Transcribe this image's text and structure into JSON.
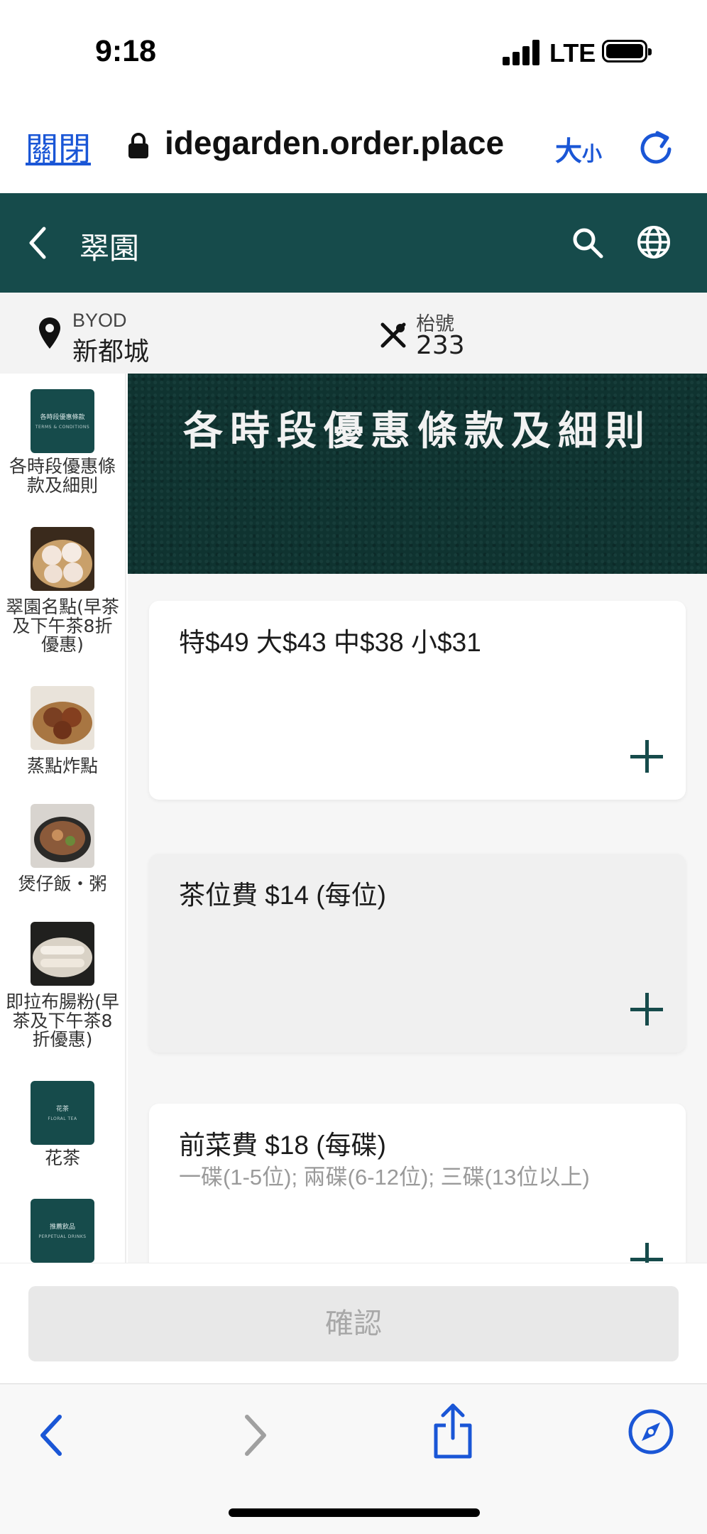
{
  "status_bar": {
    "time": "9:18",
    "network": "LTE"
  },
  "browser": {
    "close_label": "關閉",
    "url": "idegarden.order.place",
    "size_label_big": "大",
    "size_label_small": "小"
  },
  "header": {
    "title": "翠園"
  },
  "info": {
    "store_label": "BYOD",
    "store_name": "新都城",
    "table_label": "枱號",
    "table_number": "233"
  },
  "sidebar": {
    "categories": [
      {
        "label": "各時段優惠條款及細則",
        "thumb_text": "各時段優惠條款",
        "thumb_sub": "TERMS & CONDITIONS"
      },
      {
        "label": "翠園名點(早茶及下午茶8折優惠)"
      },
      {
        "label": "蒸點炸點"
      },
      {
        "label": "煲仔飯・粥"
      },
      {
        "label": "即拉布腸粉(早茶及下午茶8折優惠)"
      },
      {
        "label": "花茶",
        "thumb_text": "花茶",
        "thumb_sub": "FLORAL TEA"
      },
      {
        "label": "",
        "thumb_text": "推薦飲品",
        "thumb_sub": "PERPETUAL DRINKS"
      }
    ]
  },
  "main": {
    "banner_title": "各時段優惠條款及細則",
    "items": [
      {
        "title": "特$49 大$43 中$38 小$31",
        "subtitle": ""
      },
      {
        "title": "茶位費 $14 (每位)",
        "subtitle": ""
      },
      {
        "title": "前菜費 $18 (每碟)",
        "subtitle": "一碟(1-5位); 兩碟(6-12位); 三碟(13位以上)"
      }
    ]
  },
  "footer": {
    "confirm_label": "確認"
  },
  "colors": {
    "brand": "#164b4b",
    "link": "#1a56d6"
  }
}
